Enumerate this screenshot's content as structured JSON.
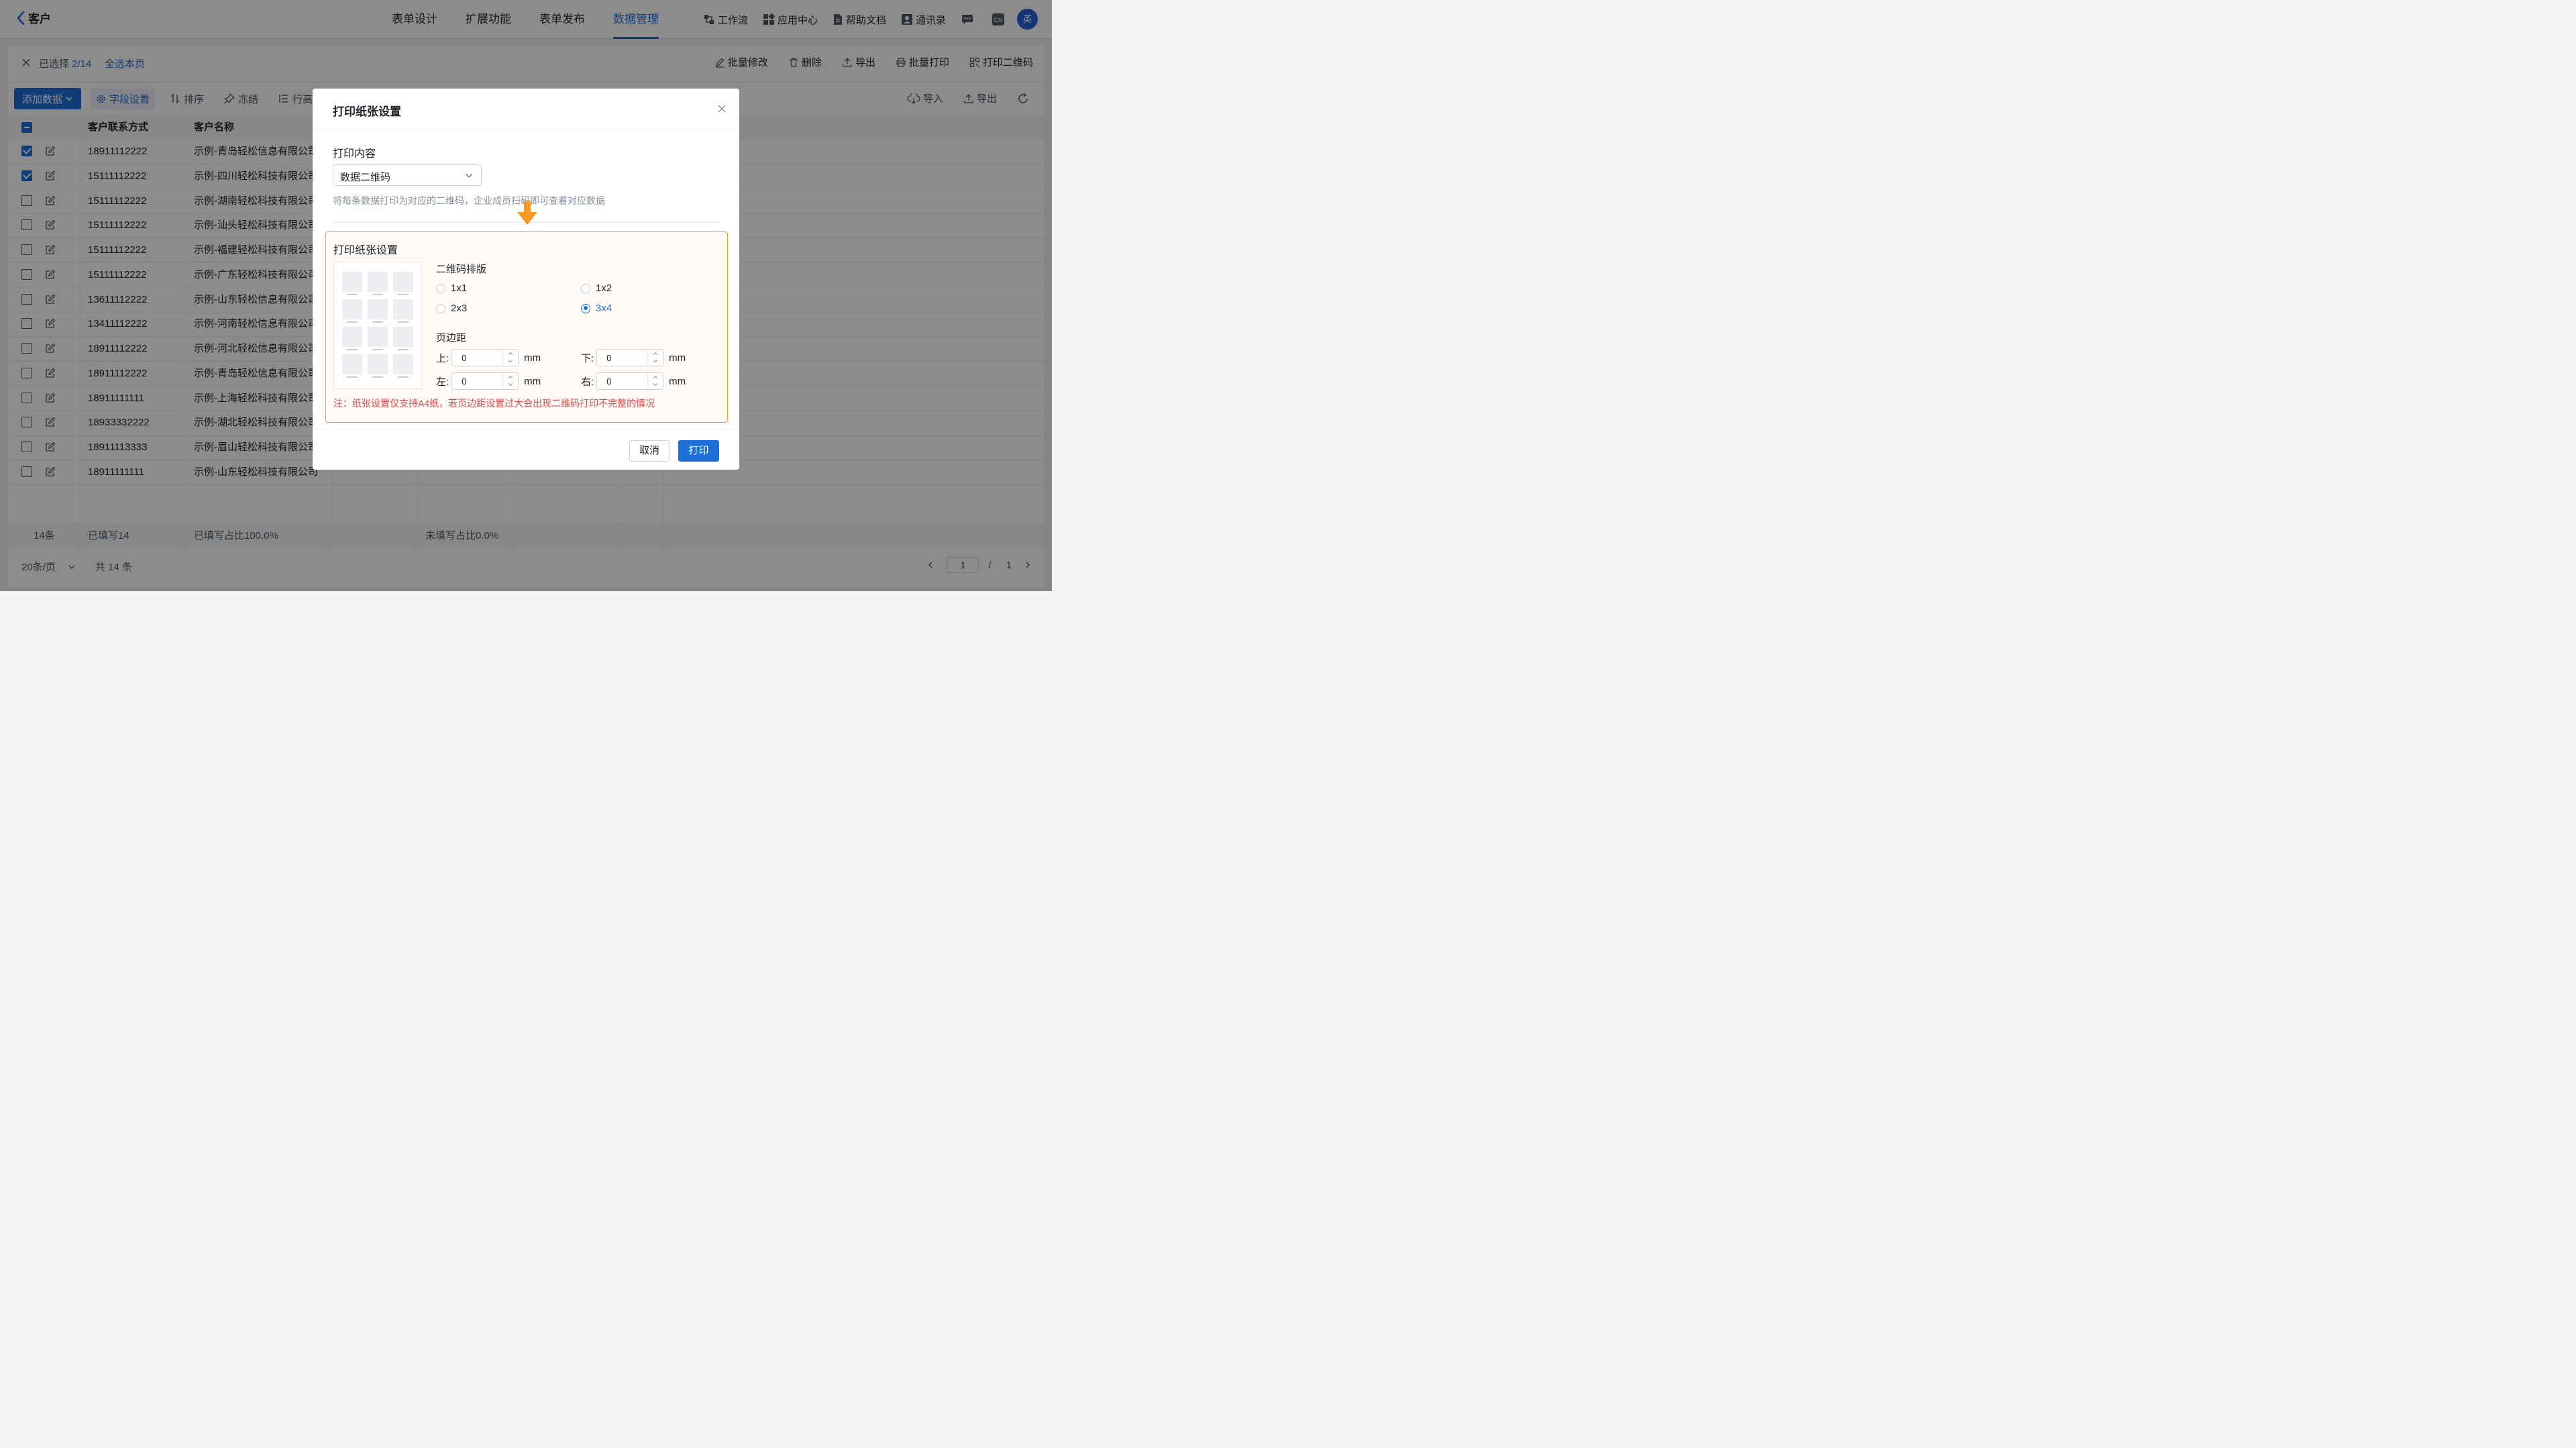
{
  "header": {
    "back_label": "客户",
    "tabs": [
      {
        "label": "表单设计"
      },
      {
        "label": "扩展功能"
      },
      {
        "label": "表单发布"
      },
      {
        "label": "数据管理"
      }
    ],
    "active_tab": "数据管理",
    "tools": [
      {
        "label": "工作流",
        "icon": "workflow-icon"
      },
      {
        "label": "应用中心",
        "icon": "app-center-icon"
      },
      {
        "label": "帮助文档",
        "icon": "doc-icon"
      },
      {
        "label": "通讯录",
        "icon": "contacts-icon"
      }
    ],
    "lang_badge": "CN",
    "avatar_text": "英"
  },
  "selection": {
    "prefix": "已选择 ",
    "count": "2/14",
    "select_all_page": "全选本页",
    "actions": [
      {
        "label": "批量修改"
      },
      {
        "label": "删除"
      },
      {
        "label": "导出"
      },
      {
        "label": "批量打印"
      },
      {
        "label": "打印二维码"
      }
    ]
  },
  "toolbar": {
    "add_data": "添加数据",
    "field_settings": "字段设置",
    "sort": "排序",
    "freeze": "冻结",
    "row_height": "行高",
    "import": "导入",
    "export": "导出"
  },
  "table": {
    "columns": [
      "客户联系方式",
      "客户名称"
    ],
    "rows": [
      {
        "checked": true,
        "phone": "18911112222",
        "name": "示例-青岛轻松信息有限公司"
      },
      {
        "checked": true,
        "phone": "15111112222",
        "name": "示例-四川轻松科技有限公司"
      },
      {
        "checked": false,
        "phone": "15111112222",
        "name": "示例-湖南轻松科技有限公司"
      },
      {
        "checked": false,
        "phone": "15111112222",
        "name": "示例-汕头轻松科技有限公司"
      },
      {
        "checked": false,
        "phone": "15111112222",
        "name": "示例-福建轻松科技有限公司"
      },
      {
        "checked": false,
        "phone": "15111112222",
        "name": "示例-广东轻松科技有限公司"
      },
      {
        "checked": false,
        "phone": "13611112222",
        "name": "示例-山东轻松信息有限公司"
      },
      {
        "checked": false,
        "phone": "13411112222",
        "name": "示例-河南轻松信息有限公司"
      },
      {
        "checked": false,
        "phone": "18911112222",
        "name": "示例-河北轻松信息有限公司"
      },
      {
        "checked": false,
        "phone": "18911112222",
        "name": "示例-青岛轻松信息有限公司"
      },
      {
        "checked": false,
        "phone": "18911111111",
        "name": "示例-上海轻松科技有限公司"
      },
      {
        "checked": false,
        "phone": "18933332222",
        "name": "示例-湖北轻松科技有限公司"
      },
      {
        "checked": false,
        "phone": "18911113333",
        "name": "示例-眉山轻松科技有限公司"
      },
      {
        "checked": false,
        "phone": "18911111111",
        "name": "示例-山东轻松科技有限公司"
      }
    ]
  },
  "summary": {
    "count": "14条",
    "filled": "已填写14",
    "filled_ratio": "已填写占比100.0%",
    "unfilled_ratio": "未填写占比0.0%"
  },
  "pagination": {
    "page_size": "20条/页",
    "total": "共 14 条",
    "current_page": "1",
    "separator": "/",
    "total_pages": "1"
  },
  "modal": {
    "title": "打印纸张设置",
    "content_label": "打印内容",
    "content_value": "数据二维码",
    "hint": "将每条数据打印为对应的二维码，企业成员扫码即可查看对应数据",
    "paper_title": "打印纸张设置",
    "layout_label": "二维码排版",
    "layout_options": [
      "1x1",
      "1x2",
      "2x3",
      "3x4"
    ],
    "layout_selected": "3x4",
    "margin_label": "页边距",
    "margins": {
      "top_label": "上:",
      "top": "0",
      "bottom_label": "下:",
      "bottom": "0",
      "left_label": "左:",
      "left": "0",
      "right_label": "右:",
      "right": "0",
      "unit": "mm"
    },
    "note": "注：纸张设置仅支持A4纸，若页边距设置过大会出现二维码打印不完整的情况",
    "cancel": "取消",
    "print": "打印"
  },
  "colors": {
    "primary": "#1e6fd9",
    "highlight_border": "#f59a23",
    "arrow": "#f59a23",
    "warning_text": "#e5484d"
  }
}
